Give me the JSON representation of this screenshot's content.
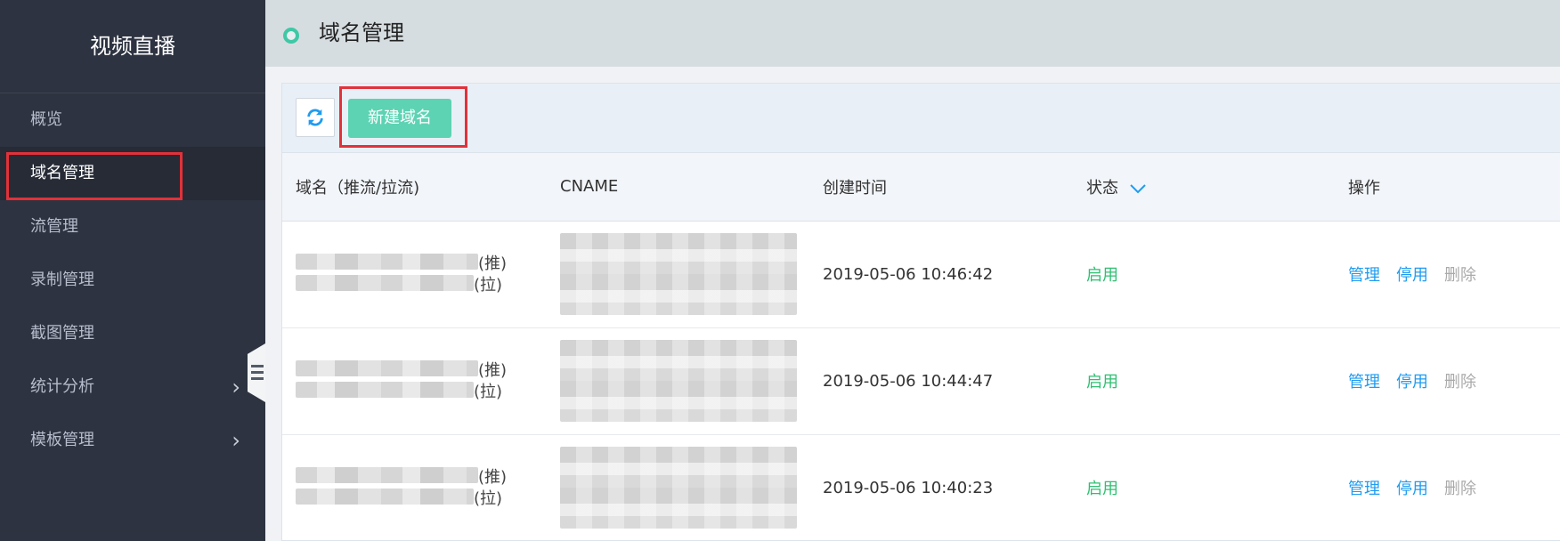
{
  "sidebar": {
    "title": "视频直播",
    "items": [
      {
        "label": "概览",
        "active": false,
        "has_arrow": false
      },
      {
        "label": "域名管理",
        "active": true,
        "has_arrow": false
      },
      {
        "label": "流管理",
        "active": false,
        "has_arrow": false
      },
      {
        "label": "录制管理",
        "active": false,
        "has_arrow": false
      },
      {
        "label": "截图管理",
        "active": false,
        "has_arrow": false
      },
      {
        "label": "统计分析",
        "active": false,
        "has_arrow": true
      },
      {
        "label": "模板管理",
        "active": false,
        "has_arrow": true
      }
    ],
    "arrow_glyph": "›"
  },
  "header": {
    "title": "域名管理"
  },
  "toolbar": {
    "refresh_icon": "refresh-icon",
    "new_button_label": "新建域名"
  },
  "table": {
    "columns": [
      "域名（推流/拉流)",
      "CNAME",
      "创建时间",
      "状态",
      "操作"
    ],
    "push_tag": "(推)",
    "pull_tag": "(拉)",
    "rows": [
      {
        "created": "2019-05-06 10:46:42",
        "status": "启用",
        "actions": [
          "管理",
          "停用",
          "删除"
        ]
      },
      {
        "created": "2019-05-06 10:44:47",
        "status": "启用",
        "actions": [
          "管理",
          "停用",
          "删除"
        ]
      },
      {
        "created": "2019-05-06 10:40:23",
        "status": "启用",
        "actions": [
          "管理",
          "停用",
          "删除"
        ]
      }
    ]
  },
  "colors": {
    "sidebar_bg": "#2d3340",
    "accent_green": "#5dd3b3",
    "status_green": "#2fbf71",
    "link_blue": "#1f9cf0",
    "highlight_red": "#e2313a"
  }
}
